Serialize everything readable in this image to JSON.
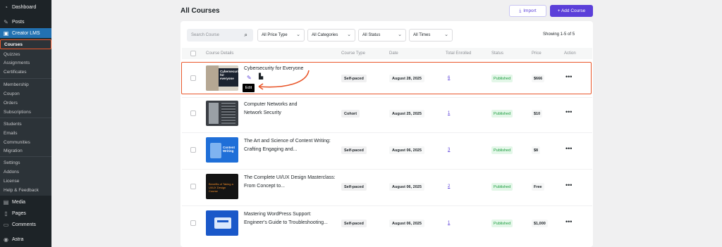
{
  "sidebar": {
    "dashboard": "Dashboard",
    "posts": "Posts",
    "creator_lms": "Creator LMS",
    "courses": "Courses",
    "quizzes": "Quizzes",
    "assignments": "Assignments",
    "certificates": "Certificates",
    "membership": "Membership",
    "coupon": "Coupon",
    "orders": "Orders",
    "subscriptions": "Subscriptions",
    "students": "Students",
    "emails": "Emails",
    "communities": "Communities",
    "migration": "Migration",
    "settings": "Settings",
    "addons": "Addons",
    "license": "License",
    "help": "Help & Feedback",
    "media": "Media",
    "pages": "Pages",
    "comments": "Comments",
    "astra": "Astra"
  },
  "header": {
    "title": "All Courses",
    "import_label": "Import",
    "add_label": "+ Add Course"
  },
  "filters": {
    "search_placeholder": "Search Course",
    "price_type": "All Price Type",
    "categories": "All Categories",
    "status": "All Status",
    "times": "All Times",
    "showing": "Showing 1-5 of 5"
  },
  "columns": {
    "details": "Course Details",
    "type": "Course Type",
    "date": "Date",
    "enrolled": "Total Enrolled",
    "status": "Status",
    "price": "Price",
    "action": "Action"
  },
  "rows": [
    {
      "title": "Cybersecurity for Everyone",
      "type": "Self-paced",
      "date": "August 28, 2025",
      "enrolled": "6",
      "status": "Published",
      "price": "$666",
      "thumb_text": "Cybersecurity for everyone"
    },
    {
      "title": "Computer Networks and Network Security",
      "type": "Cohort",
      "date": "August 25, 2025",
      "enrolled": "1",
      "status": "Published",
      "price": "$10"
    },
    {
      "title": "The Art and Science of Content Writing: Crafting Engaging and...",
      "type": "Self-paced",
      "date": "August 06, 2025",
      "enrolled": "3",
      "status": "Published",
      "price": "$8",
      "thumb_text": "Content Writing"
    },
    {
      "title": "The Complete UI/UX Design Masterclass: From Concept to...",
      "type": "Self-paced",
      "date": "August 06, 2025",
      "enrolled": "2",
      "status": "Published",
      "price": "Free",
      "thumb_text": "Benefits of Taking a UI/UX Design Course"
    },
    {
      "title": "Mastering WordPress Support: Engineer's Guide to Troubleshooting...",
      "type": "Self-paced",
      "date": "August 06, 2025",
      "enrolled": "1",
      "status": "Published",
      "price": "$1,000"
    }
  ],
  "tooltip": {
    "edit": "Edit"
  },
  "colors": {
    "accent": "#5b3fd9",
    "highlight": "#e9572b",
    "published": "#1a9b3c"
  }
}
